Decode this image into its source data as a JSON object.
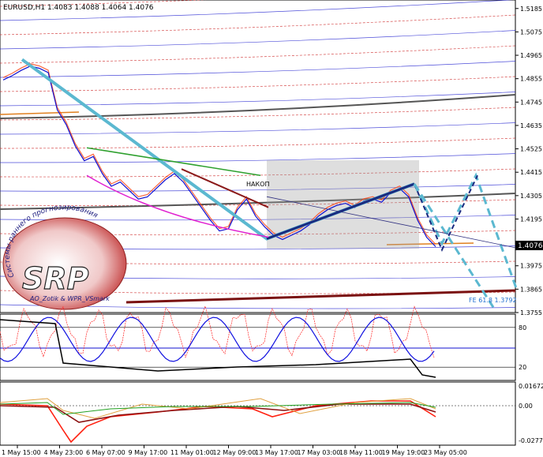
{
  "chart_data": {
    "type": "line",
    "title": "EURUSD,H1  1.4083 1.4088 1.4064 1.4076",
    "symbol": "EURUSD,H1",
    "ohlc": {
      "open": 1.4083,
      "high": 1.4088,
      "low": 1.4064,
      "close": 1.4076
    },
    "current_price_label": "1.4076",
    "y_ticks": [
      1.5185,
      1.5075,
      1.4965,
      1.4855,
      1.4745,
      1.4635,
      1.4525,
      1.4415,
      1.4305,
      1.4195,
      1.3975,
      1.3865,
      1.3755
    ],
    "x_ticks": [
      "1 May 15:00",
      "4 May 23:00",
      "6 May 07:00",
      "9 May 17:00",
      "11 May 01:00",
      "12 May 09:00",
      "13 May 17:00",
      "17 May 03:00",
      "18 May 11:00",
      "19 May 19:00",
      "23 May 05:00"
    ],
    "ylim": [
      1.3755,
      1.5225
    ],
    "annotations": {
      "label1": "НАКОП",
      "fibo": "FE 61.8 1.3792"
    },
    "price_series": {
      "name": "EURUSD H1",
      "values": [
        1.486,
        1.488,
        1.4905,
        1.4925,
        1.4915,
        1.4895,
        1.472,
        1.465,
        1.455,
        1.448,
        1.45,
        1.442,
        1.436,
        1.438,
        1.434,
        1.43,
        1.431,
        1.435,
        1.439,
        1.442,
        1.438,
        1.432,
        1.426,
        1.42,
        1.415,
        1.416,
        1.425,
        1.43,
        1.422,
        1.417,
        1.413,
        1.411,
        1.413,
        1.415,
        1.418,
        1.422,
        1.425,
        1.427,
        1.428,
        1.426,
        1.429,
        1.43,
        1.4285,
        1.433,
        1.435,
        1.431,
        1.42,
        1.412,
        1.4076
      ]
    },
    "forecast_levels": [
      1.436,
      1.409,
      1.3792,
      1.44,
      1.3855
    ],
    "indicator1": {
      "levels": [
        20,
        80
      ],
      "range": [
        0,
        100
      ]
    },
    "indicator2": {
      "ticks": [
        0.01672,
        0.0,
        -0.02773
      ]
    }
  },
  "logo": {
    "text": "SRP",
    "arc_text": "Системы раннего прогнозирования",
    "sub_text": "AO_Zotik & WPR_VSmark"
  },
  "colors": {
    "price_up": "#1010d0",
    "price_down": "#ff4010",
    "trend": "#5bb8d0",
    "wave": "#1a2a80",
    "level_red": "#cc2020",
    "level_blue": "#2020d0"
  }
}
